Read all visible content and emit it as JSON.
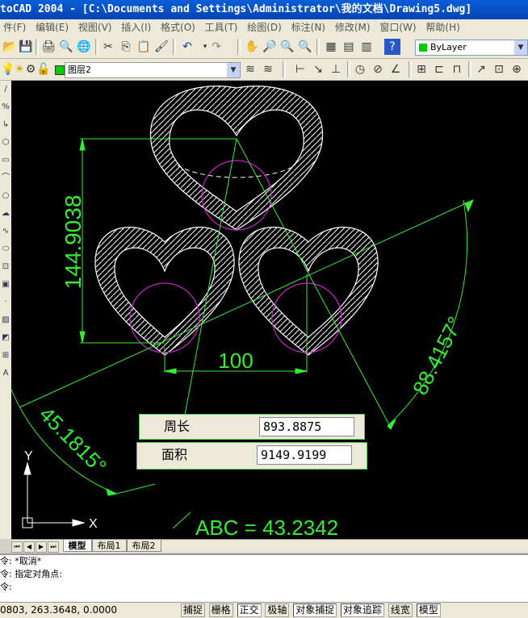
{
  "window": {
    "title": "toCAD 2004 - [C:\\Documents and Settings\\Administrator\\我的文档\\Drawing5.dwg]"
  },
  "menu": [
    "件(F)",
    "编辑(E)",
    "视图(V)",
    "插入(I)",
    "格式(O)",
    "工具(T)",
    "绘图(D)",
    "标注(N)",
    "修改(M)",
    "窗口(W)",
    "帮助(H)"
  ],
  "toolbar": {
    "color_combo": "ByLayer",
    "layer_combo": "图层2"
  },
  "drawing": {
    "dim_height": "144.9038",
    "dim_width": "100",
    "dim_angle_right": "88.4157°",
    "dim_angle_left": "45.1815°",
    "abc_label": "ABC = 43.2342",
    "ucs_x": "X",
    "ucs_y": "Y"
  },
  "props": {
    "perimeter_label": "周长",
    "perimeter_value": "893.8875",
    "area_label": "面积",
    "area_value": "9149.9199"
  },
  "tabs": [
    "模型",
    "布局1",
    "布局2"
  ],
  "active_tab": "模型",
  "command": [
    "令: *取消*",
    "令: 指定对角点:",
    "令:"
  ],
  "status": {
    "coords": "0803, 263.3648, 0.0000",
    "buttons": [
      "捕捉",
      "栅格",
      "正交",
      "极轴",
      "对象捕捉",
      "对象追踪",
      "线宽",
      "模型"
    ]
  },
  "colors": {
    "dim": "#33ee33",
    "geometry": "#ffffff",
    "circle": "#cc22cc",
    "canvas": "#000000"
  }
}
